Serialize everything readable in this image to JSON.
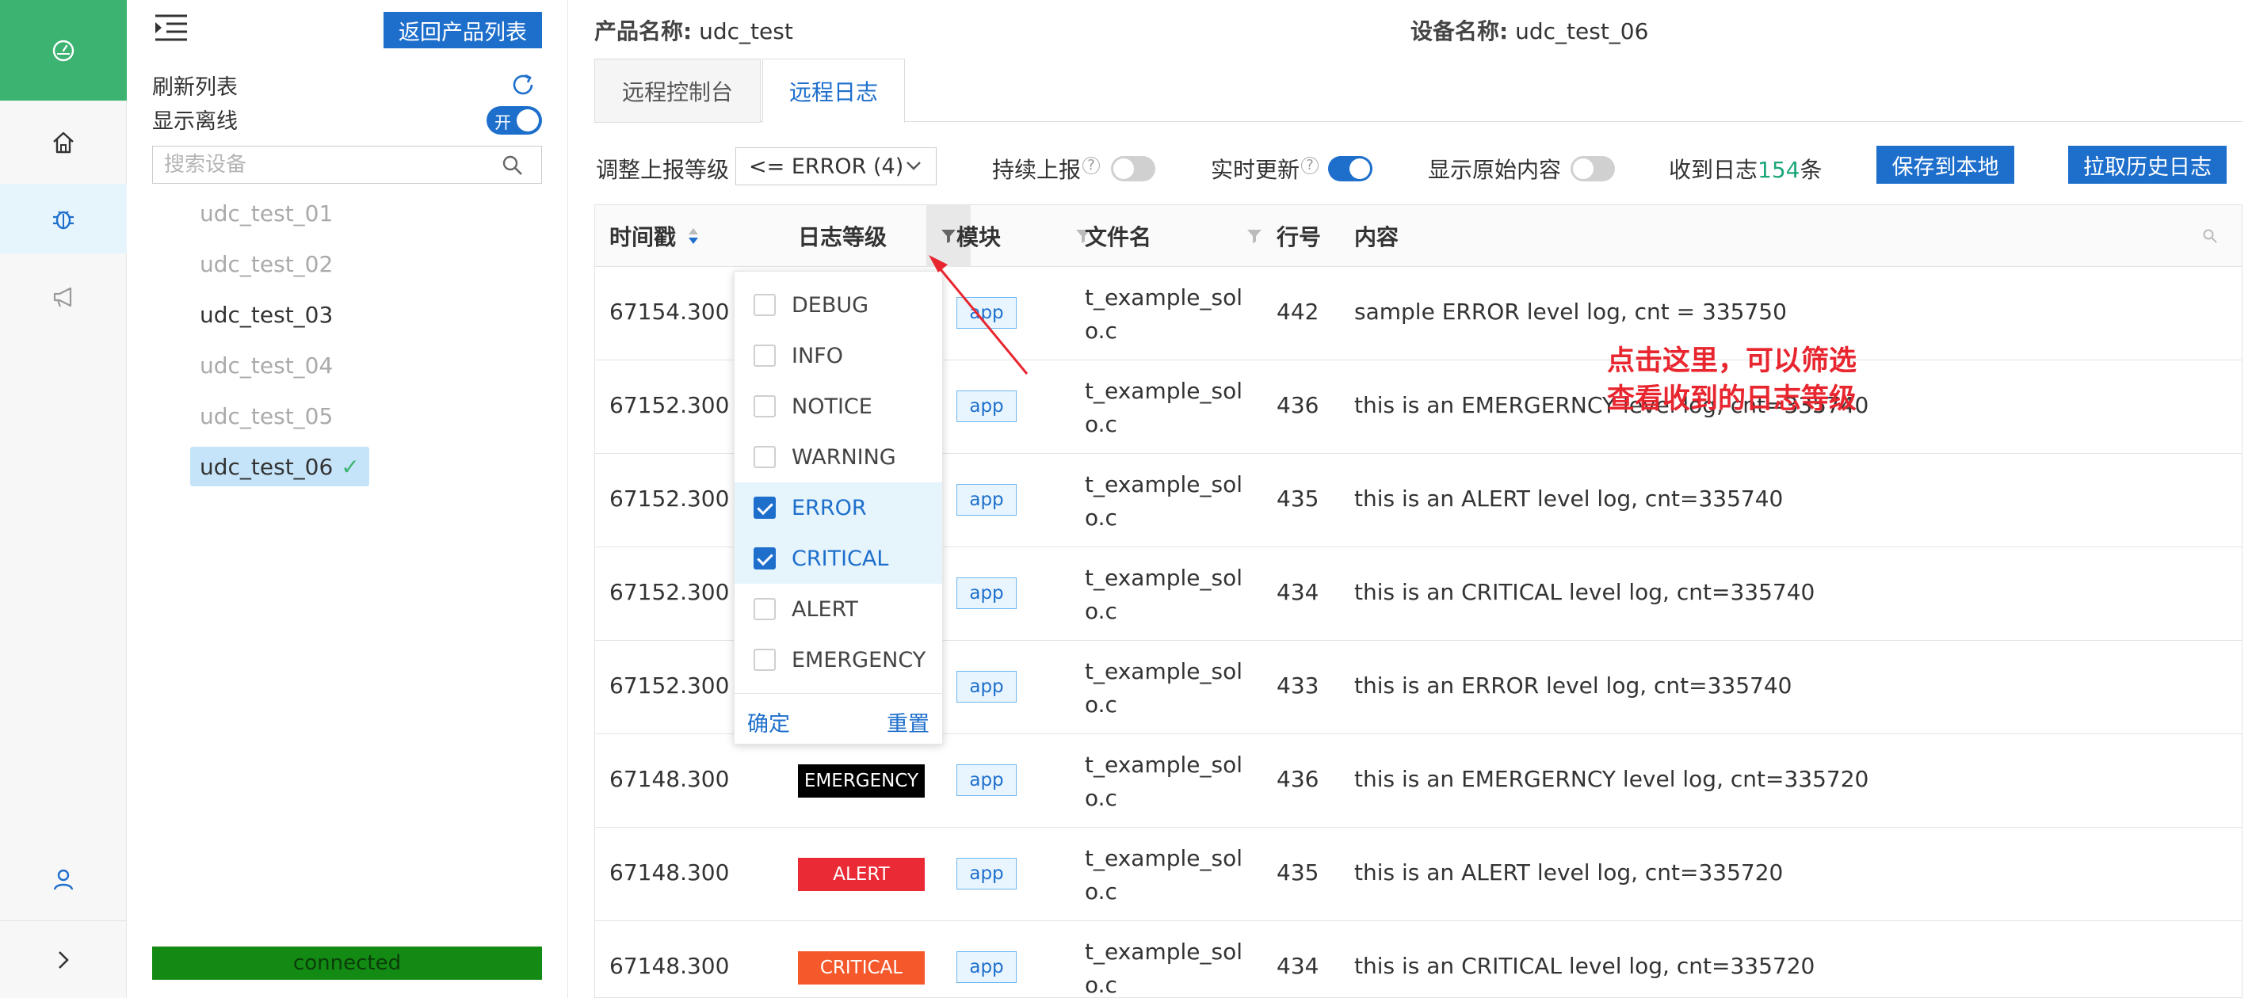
{
  "rail": {
    "items": [
      "dashboard-icon",
      "home-icon",
      "bug-icon",
      "megaphone-icon",
      "user-icon",
      "chevron-right-icon"
    ]
  },
  "device_panel": {
    "back_button": "返回产品列表",
    "refresh_label": "刷新列表",
    "offline_label": "显示离线",
    "offline_toggle_label": "开",
    "search_placeholder": "搜索设备",
    "devices": [
      {
        "name": "udc_test_01",
        "state": "offline"
      },
      {
        "name": "udc_test_02",
        "state": "offline"
      },
      {
        "name": "udc_test_03",
        "state": "online"
      },
      {
        "name": "udc_test_04",
        "state": "offline"
      },
      {
        "name": "udc_test_05",
        "state": "offline"
      },
      {
        "name": "udc_test_06",
        "state": "selected",
        "check": "✓"
      }
    ],
    "status": "connected"
  },
  "header": {
    "product_label": "产品名称:",
    "product_value": "udc_test",
    "device_label": "设备名称:",
    "device_value": "udc_test_06"
  },
  "tabs": [
    "远程控制台",
    "远程日志"
  ],
  "toolbar": {
    "level_label": "调整上报等级",
    "level_value": "<= ERROR (4)",
    "persist_label": "持续上报",
    "realtime_label": "实时更新",
    "raw_label": "显示原始内容",
    "count_prefix": "收到日志",
    "count_value": "154",
    "count_suffix": "条",
    "save_button": "保存到本地",
    "history_button": "拉取历史日志",
    "help_glyph": "?"
  },
  "table": {
    "columns": [
      "时间戳",
      "日志等级",
      "模块",
      "文件名",
      "行号",
      "内容"
    ],
    "rows": [
      {
        "time": "67154.300",
        "module": "app",
        "file": "t_example_solo.c",
        "line": "442",
        "content": "sample ERROR level log, cnt = 335750",
        "level": ""
      },
      {
        "time": "67152.300",
        "module": "app",
        "file": "t_example_solo.c",
        "line": "436",
        "content": "this is an EMERGERNCY level log, cnt=335740",
        "level": ""
      },
      {
        "time": "67152.300",
        "module": "app",
        "file": "t_example_solo.c",
        "line": "435",
        "content": "this is an ALERT level log, cnt=335740",
        "level": ""
      },
      {
        "time": "67152.300",
        "module": "app",
        "file": "t_example_solo.c",
        "line": "434",
        "content": "this is an CRITICAL level log, cnt=335740",
        "level": ""
      },
      {
        "time": "67152.300",
        "module": "app",
        "file": "t_example_solo.c",
        "line": "433",
        "content": "this is an ERROR level log, cnt=335740",
        "level": ""
      },
      {
        "time": "67148.300",
        "module": "app",
        "file": "t_example_solo.c",
        "line": "436",
        "content": "this is an EMERGERNCY level log, cnt=335720",
        "level": "EMERGENCY",
        "level_color": "#000000"
      },
      {
        "time": "67148.300",
        "module": "app",
        "file": "t_example_solo.c",
        "line": "435",
        "content": "this is an ALERT level log, cnt=335720",
        "level": "ALERT",
        "level_color": "#ea2a35"
      },
      {
        "time": "67148.300",
        "module": "app",
        "file": "t_example_solo.c",
        "line": "434",
        "content": "this is an CRITICAL level log, cnt=335720",
        "level": "CRITICAL",
        "level_color": "#f5582a"
      }
    ]
  },
  "filter_dropdown": {
    "options": [
      {
        "label": "DEBUG",
        "checked": false
      },
      {
        "label": "INFO",
        "checked": false
      },
      {
        "label": "NOTICE",
        "checked": false
      },
      {
        "label": "WARNING",
        "checked": false
      },
      {
        "label": "ERROR",
        "checked": true
      },
      {
        "label": "CRITICAL",
        "checked": true
      },
      {
        "label": "ALERT",
        "checked": false
      },
      {
        "label": "EMERGENCY",
        "checked": false
      }
    ],
    "confirm": "确定",
    "reset": "重置"
  },
  "annotation": {
    "line1": "点击这里，可以筛选",
    "line2": "查看收到的日志等级",
    "color": "#e8262f"
  },
  "colors": {
    "primary": "#1e6fcc",
    "rail_active": "#3cb371",
    "status_green": "#138a13",
    "count_green": "#1aa67a"
  }
}
